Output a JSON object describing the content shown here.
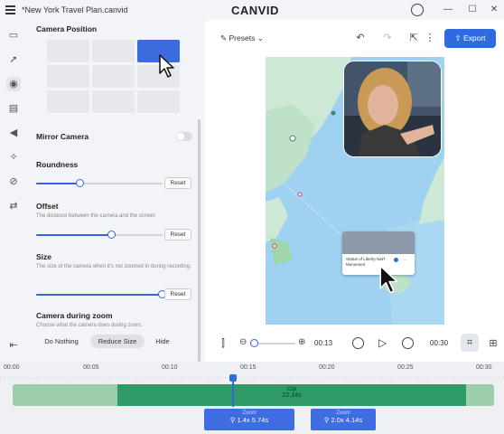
{
  "titlebar": {
    "doc_title": "*New York Travel Plan.canvid",
    "brand": "CANVID",
    "minimize": "—",
    "maximize": "☐",
    "close": "✕"
  },
  "panel": {
    "camera_position_label": "Camera Position",
    "mirror_label": "Mirror Camera",
    "roundness_label": "Roundness",
    "roundness_value": 0.35,
    "offset_label": "Offset",
    "offset_desc": "The distance between the camera and the screen",
    "offset_value": 0.6,
    "size_label": "Size",
    "size_desc": "The size of the camera when it's not zoomed in during recording.",
    "size_value": 1.0,
    "reset_label": "Reset",
    "zoom_label": "Camera during zoom",
    "zoom_desc": "Choose what the camera does during zoom.",
    "zoom_options": [
      "Do Nothing",
      "Reduce Size",
      "Hide"
    ],
    "zoom_selected": "Reduce Size"
  },
  "toolbar": {
    "presets_label": "Presets",
    "export_label": "Export"
  },
  "canvas": {
    "tooltip_title": "Statue of Liberty Nat'l Monument"
  },
  "playback": {
    "current_time": "00:13",
    "total_time": "00:30"
  },
  "timeline": {
    "ticks": [
      "00:00",
      "00:05",
      "00:10",
      "00:15",
      "00:20",
      "00:25",
      "00:30"
    ],
    "clip_label": "Clip",
    "clip_duration": "22.14s",
    "zoom1_label": "Zoom",
    "zoom1_detail": "1.4x  5.74s",
    "zoom2_label": "Zoom",
    "zoom2_detail": "2.0x  4.14s"
  },
  "colors": {
    "accent": "#2f6ae0",
    "clip_green": "#2e9b66",
    "water": "#9fd1f0",
    "land": "#cde8d5"
  }
}
